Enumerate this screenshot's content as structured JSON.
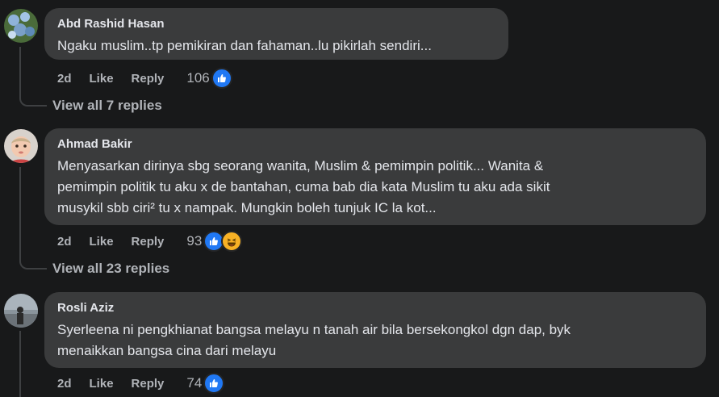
{
  "comments": [
    {
      "author": "Abd Rashid Hasan",
      "text_lines": [
        "Ngaku muslim..tp pemikiran dan fahaman..lu pikirlah sendiri..."
      ],
      "time": "2d",
      "like_label": "Like",
      "reply_label": "Reply",
      "reaction_count": "106",
      "view_replies": "View all 7 replies"
    },
    {
      "author": "Ahmad Bakir",
      "text_lines": [
        "Menyasarkan dirinya sbg seorang wanita, Muslim & pemimpin politik... Wanita &",
        "pemimpin politik tu aku x de bantahan, cuma bab dia kata Muslim tu aku ada sikit",
        "musykil sbb ciri² tu x nampak. Mungkin boleh tunjuk IC la kot..."
      ],
      "time": "2d",
      "like_label": "Like",
      "reply_label": "Reply",
      "reaction_count": "93",
      "view_replies": "View all 23 replies"
    },
    {
      "author": "Rosli Aziz",
      "text_lines": [
        "Syerleena ni pengkhianat bangsa melayu n tanah air bila bersekongkol dgn dap, byk",
        "menaikkan bangsa cina dari melayu"
      ],
      "time": "2d",
      "like_label": "Like",
      "reply_label": "Reply",
      "reaction_count": "74"
    }
  ],
  "colors": {
    "background": "#18191a",
    "bubble": "#3a3b3c",
    "like_blue": "#2078f4",
    "secondary_text": "#b0b3b8"
  },
  "icons": [
    "like-reaction-icon",
    "haha-reaction-icon"
  ]
}
